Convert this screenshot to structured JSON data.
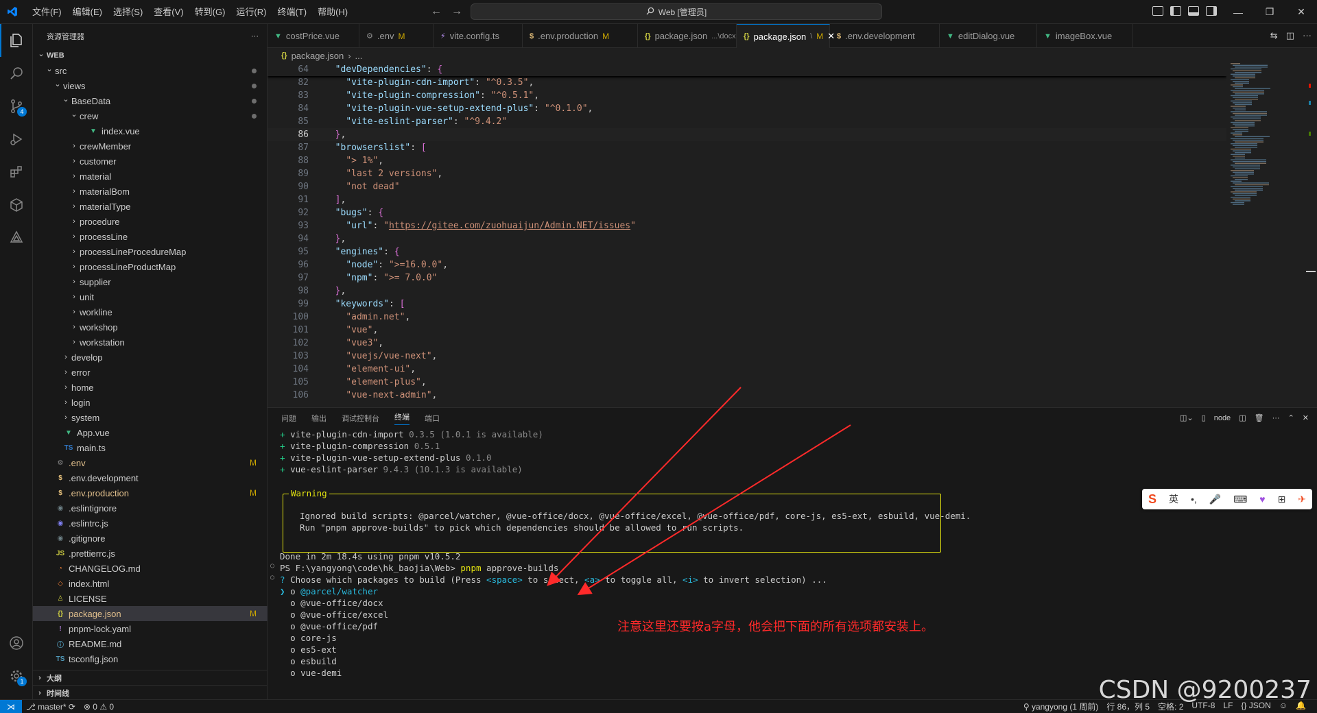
{
  "titlebar": {
    "menu": [
      "文件(F)",
      "编辑(E)",
      "选择(S)",
      "查看(V)",
      "转到(G)",
      "运行(R)",
      "终端(T)",
      "帮助(H)"
    ],
    "search": "Web [管理员]"
  },
  "sidebar": {
    "title": "资源管理器",
    "more": "···",
    "tree": [
      {
        "label": "WEB",
        "depth": 0,
        "type": "folder-open",
        "bold": true
      },
      {
        "label": "src",
        "depth": 1,
        "type": "folder-open",
        "dot": true
      },
      {
        "label": "views",
        "depth": 2,
        "type": "folder-open",
        "dot": true
      },
      {
        "label": "BaseData",
        "depth": 3,
        "type": "folder-open",
        "dot": true
      },
      {
        "label": "crew",
        "depth": 4,
        "type": "folder-open",
        "dot": true
      },
      {
        "label": "index.vue",
        "depth": 5,
        "type": "vue"
      },
      {
        "label": "crewMember",
        "depth": 4,
        "type": "folder"
      },
      {
        "label": "customer",
        "depth": 4,
        "type": "folder"
      },
      {
        "label": "material",
        "depth": 4,
        "type": "folder"
      },
      {
        "label": "materialBom",
        "depth": 4,
        "type": "folder"
      },
      {
        "label": "materialType",
        "depth": 4,
        "type": "folder"
      },
      {
        "label": "procedure",
        "depth": 4,
        "type": "folder"
      },
      {
        "label": "processLine",
        "depth": 4,
        "type": "folder"
      },
      {
        "label": "processLineProcedureMap",
        "depth": 4,
        "type": "folder"
      },
      {
        "label": "processLineProductMap",
        "depth": 4,
        "type": "folder"
      },
      {
        "label": "supplier",
        "depth": 4,
        "type": "folder"
      },
      {
        "label": "unit",
        "depth": 4,
        "type": "folder"
      },
      {
        "label": "workline",
        "depth": 4,
        "type": "folder"
      },
      {
        "label": "workshop",
        "depth": 4,
        "type": "folder"
      },
      {
        "label": "workstation",
        "depth": 4,
        "type": "folder"
      },
      {
        "label": "develop",
        "depth": 3,
        "type": "folder"
      },
      {
        "label": "error",
        "depth": 3,
        "type": "folder"
      },
      {
        "label": "home",
        "depth": 3,
        "type": "folder"
      },
      {
        "label": "login",
        "depth": 3,
        "type": "folder"
      },
      {
        "label": "system",
        "depth": 3,
        "type": "folder"
      },
      {
        "label": "App.vue",
        "depth": 2,
        "type": "vue"
      },
      {
        "label": "main.ts",
        "depth": 2,
        "type": "ts"
      },
      {
        "label": ".env",
        "depth": 1,
        "type": "gear",
        "mod": "M"
      },
      {
        "label": ".env.development",
        "depth": 1,
        "type": "dollar"
      },
      {
        "label": ".env.production",
        "depth": 1,
        "type": "dollar",
        "mod": "M"
      },
      {
        "label": ".eslintignore",
        "depth": 1,
        "type": "circle"
      },
      {
        "label": ".eslintrc.js",
        "depth": 1,
        "type": "eslint"
      },
      {
        "label": ".gitignore",
        "depth": 1,
        "type": "git"
      },
      {
        "label": ".prettierrc.js",
        "depth": 1,
        "type": "js"
      },
      {
        "label": "CHANGELOG.md",
        "depth": 1,
        "type": "changelog"
      },
      {
        "label": "index.html",
        "depth": 1,
        "type": "html"
      },
      {
        "label": "LICENSE",
        "depth": 1,
        "type": "license"
      },
      {
        "label": "package.json",
        "depth": 1,
        "type": "json",
        "mod": "M",
        "selected": true
      },
      {
        "label": "pnpm-lock.yaml",
        "depth": 1,
        "type": "yaml"
      },
      {
        "label": "README.md",
        "depth": 1,
        "type": "info"
      },
      {
        "label": "tsconfig.json",
        "depth": 1,
        "type": "tsconfig"
      }
    ],
    "outline": "大纲",
    "timeline": "时间线"
  },
  "tabs": [
    {
      "label": "costPrice.vue",
      "icon": "vue"
    },
    {
      "label": ".env",
      "icon": "gear",
      "mod": "M"
    },
    {
      "label": "vite.config.ts",
      "icon": "vite"
    },
    {
      "label": ".env.production",
      "icon": "dollar",
      "mod": "M"
    },
    {
      "label": "package.json",
      "icon": "json",
      "desc": "...\\docx"
    },
    {
      "label": "package.json",
      "icon": "json",
      "desc": "\\",
      "mod": "M",
      "active": true
    },
    {
      "label": ".env.development",
      "icon": "dollar"
    },
    {
      "label": "editDialog.vue",
      "icon": "vue"
    },
    {
      "label": "imageBox.vue",
      "icon": "vue"
    }
  ],
  "breadcrumb": [
    "package.json",
    "..."
  ],
  "editor": {
    "sticky": {
      "ln": "64",
      "code": "  \"devDependencies\": {"
    },
    "lines": [
      {
        "ln": "82",
        "parts": [
          [
            "p",
            "    "
          ],
          [
            "k",
            "\"vite-plugin-cdn-import\""
          ],
          [
            "p",
            ": "
          ],
          [
            "s",
            "\"^0.3.5\""
          ],
          [
            "p",
            ","
          ]
        ]
      },
      {
        "ln": "83",
        "parts": [
          [
            "p",
            "    "
          ],
          [
            "k",
            "\"vite-plugin-compression\""
          ],
          [
            "p",
            ": "
          ],
          [
            "s",
            "\"^0.5.1\""
          ],
          [
            "p",
            ","
          ]
        ]
      },
      {
        "ln": "84",
        "parts": [
          [
            "p",
            "    "
          ],
          [
            "k",
            "\"vite-plugin-vue-setup-extend-plus\""
          ],
          [
            "p",
            ": "
          ],
          [
            "s",
            "\"^0.1.0\""
          ],
          [
            "p",
            ","
          ]
        ]
      },
      {
        "ln": "85",
        "parts": [
          [
            "p",
            "    "
          ],
          [
            "k",
            "\"vite-eslint-parser\""
          ],
          [
            "p",
            ": "
          ],
          [
            "s",
            "\"^9.4.2\""
          ]
        ]
      },
      {
        "ln": "86",
        "parts": [
          [
            "p",
            "  "
          ],
          [
            "b2",
            "}"
          ],
          [
            "p",
            ","
          ]
        ],
        "current": true
      },
      {
        "ln": "87",
        "parts": [
          [
            "p",
            "  "
          ],
          [
            "k",
            "\"browserslist\""
          ],
          [
            "p",
            ": "
          ],
          [
            "b2",
            "["
          ]
        ]
      },
      {
        "ln": "88",
        "parts": [
          [
            "p",
            "    "
          ],
          [
            "s",
            "\"> 1%\""
          ],
          [
            "p",
            ","
          ]
        ]
      },
      {
        "ln": "89",
        "parts": [
          [
            "p",
            "    "
          ],
          [
            "s",
            "\"last 2 versions\""
          ],
          [
            "p",
            ","
          ]
        ]
      },
      {
        "ln": "90",
        "parts": [
          [
            "p",
            "    "
          ],
          [
            "s",
            "\"not dead\""
          ]
        ]
      },
      {
        "ln": "91",
        "parts": [
          [
            "p",
            "  "
          ],
          [
            "b2",
            "]"
          ],
          [
            "p",
            ","
          ]
        ]
      },
      {
        "ln": "92",
        "parts": [
          [
            "p",
            "  "
          ],
          [
            "k",
            "\"bugs\""
          ],
          [
            "p",
            ": "
          ],
          [
            "b2",
            "{"
          ]
        ]
      },
      {
        "ln": "93",
        "parts": [
          [
            "p",
            "    "
          ],
          [
            "k",
            "\"url\""
          ],
          [
            "p",
            ": "
          ],
          [
            "s",
            "\""
          ],
          [
            "url",
            "https://gitee.com/zuohuaijun/Admin.NET/issues"
          ],
          [
            "s",
            "\""
          ]
        ]
      },
      {
        "ln": "94",
        "parts": [
          [
            "p",
            "  "
          ],
          [
            "b2",
            "}"
          ],
          [
            "p",
            ","
          ]
        ]
      },
      {
        "ln": "95",
        "parts": [
          [
            "p",
            "  "
          ],
          [
            "k",
            "\"engines\""
          ],
          [
            "p",
            ": "
          ],
          [
            "b2",
            "{"
          ]
        ]
      },
      {
        "ln": "96",
        "parts": [
          [
            "p",
            "    "
          ],
          [
            "k",
            "\"node\""
          ],
          [
            "p",
            ": "
          ],
          [
            "s",
            "\">=16.0.0\""
          ],
          [
            "p",
            ","
          ]
        ]
      },
      {
        "ln": "97",
        "parts": [
          [
            "p",
            "    "
          ],
          [
            "k",
            "\"npm\""
          ],
          [
            "p",
            ": "
          ],
          [
            "s",
            "\">= 7.0.0\""
          ]
        ]
      },
      {
        "ln": "98",
        "parts": [
          [
            "p",
            "  "
          ],
          [
            "b2",
            "}"
          ],
          [
            "p",
            ","
          ]
        ]
      },
      {
        "ln": "99",
        "parts": [
          [
            "p",
            "  "
          ],
          [
            "k",
            "\"keywords\""
          ],
          [
            "p",
            ": "
          ],
          [
            "b2",
            "["
          ]
        ]
      },
      {
        "ln": "100",
        "parts": [
          [
            "p",
            "    "
          ],
          [
            "s",
            "\"admin.net\""
          ],
          [
            "p",
            ","
          ]
        ]
      },
      {
        "ln": "101",
        "parts": [
          [
            "p",
            "    "
          ],
          [
            "s",
            "\"vue\""
          ],
          [
            "p",
            ","
          ]
        ]
      },
      {
        "ln": "102",
        "parts": [
          [
            "p",
            "    "
          ],
          [
            "s",
            "\"vue3\""
          ],
          [
            "p",
            ","
          ]
        ]
      },
      {
        "ln": "103",
        "parts": [
          [
            "p",
            "    "
          ],
          [
            "s",
            "\"vuejs/vue-next\""
          ],
          [
            "p",
            ","
          ]
        ]
      },
      {
        "ln": "104",
        "parts": [
          [
            "p",
            "    "
          ],
          [
            "s",
            "\"element-ui\""
          ],
          [
            "p",
            ","
          ]
        ]
      },
      {
        "ln": "105",
        "parts": [
          [
            "p",
            "    "
          ],
          [
            "s",
            "\"element-plus\""
          ],
          [
            "p",
            ","
          ]
        ]
      },
      {
        "ln": "106",
        "parts": [
          [
            "p",
            "    "
          ],
          [
            "s",
            "\"vue-next-admin\""
          ],
          [
            "p",
            ","
          ]
        ]
      }
    ]
  },
  "panel": {
    "tabs": [
      "问题",
      "输出",
      "调试控制台",
      "终端",
      "端口"
    ],
    "active_tab": "终端",
    "terminal_name": "node",
    "terminal": {
      "deps": [
        {
          "name": "vite-plugin-cdn-import",
          "ver": "0.3.5",
          "avail": "(1.0.1 is available)"
        },
        {
          "name": "vite-plugin-compression",
          "ver": "0.5.1",
          "avail": ""
        },
        {
          "name": "vite-plugin-vue-setup-extend-plus",
          "ver": "0.1.0",
          "avail": ""
        },
        {
          "name": "vue-eslint-parser",
          "ver": "9.4.3",
          "avail": "(10.1.3 is available)"
        }
      ],
      "warning_title": "Warning",
      "warning_line1": "Ignored build scripts: @parcel/watcher, @vue-office/docx, @vue-office/excel, @vue-office/pdf, core-js, es5-ext, esbuild, vue-demi.",
      "warning_line2": "Run \"pnpm approve-builds\" to pick which dependencies should be allowed to run scripts.",
      "done": "Done in 2m 18.4s using pnpm v10.5.2",
      "prompt": "PS F:\\yangyong\\code\\hk_baojia\\Web>",
      "cmd_pnpm": "pnpm",
      "cmd_rest": "approve-builds",
      "choose_prefix": "Choose which packages to build (Press ",
      "key_space": "<space>",
      "choose_mid1": " to select, ",
      "key_a": "<a>",
      "choose_mid2": " to toggle all, ",
      "key_i": "<i>",
      "choose_end": " to invert selection) ...",
      "options": [
        "@parcel/watcher",
        "@vue-office/docx",
        "@vue-office/excel",
        "@vue-office/pdf",
        "core-js",
        "es5-ext",
        "esbuild",
        "vue-demi"
      ]
    }
  },
  "annotation": "注意这里还要按a字母，他会把下面的所有选项都安装上。",
  "ime": [
    "英"
  ],
  "statusbar": {
    "branch": "master*",
    "errors": "0",
    "warnings": "0",
    "author": "yangyong (1 周前)",
    "position": "行 86，列 5",
    "spaces": "空格: 2",
    "encoding": "UTF-8",
    "eol": "LF",
    "language": "JSON"
  },
  "watermark": "CSDN @9200237",
  "colors": {
    "accent": "#0078d4",
    "annotation": "#ff2a2a",
    "warning": "#e5e510"
  }
}
